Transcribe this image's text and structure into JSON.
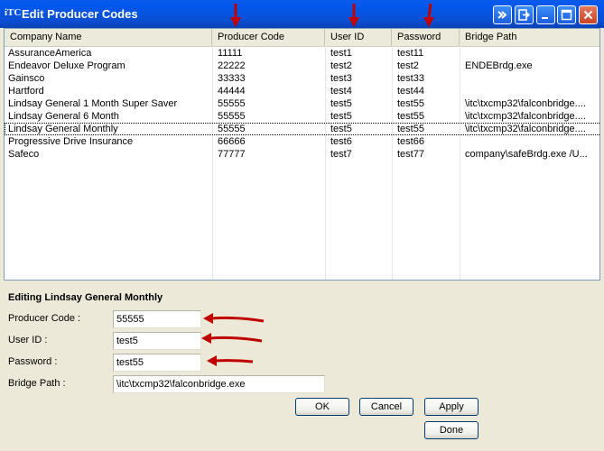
{
  "window": {
    "icon_text": "iTC",
    "title": "Edit Producer Codes"
  },
  "list": {
    "columns": [
      "Company Name",
      "Producer Code",
      "User ID",
      "Password",
      "Bridge Path"
    ],
    "rows": [
      [
        "AssuranceAmerica",
        "11111",
        "test1",
        "test11",
        ""
      ],
      [
        "Endeavor Deluxe Program",
        "22222",
        "test2",
        "test2",
        "ENDEBrdg.exe"
      ],
      [
        "Gainsco",
        "33333",
        "test3",
        "test33",
        ""
      ],
      [
        "Hartford",
        "44444",
        "test4",
        "test44",
        ""
      ],
      [
        "Lindsay General 1 Month Super Saver",
        "55555",
        "test5",
        "test55",
        "\\itc\\txcmp32\\falconbridge...."
      ],
      [
        "Lindsay General 6 Month",
        "55555",
        "test5",
        "test55",
        "\\itc\\txcmp32\\falconbridge...."
      ],
      [
        "Lindsay General Monthly",
        "55555",
        "test5",
        "test55",
        "\\itc\\txcmp32\\falconbridge...."
      ],
      [
        "Progressive Drive Insurance",
        "66666",
        "test6",
        "test66",
        ""
      ],
      [
        "Safeco",
        "77777",
        "test7",
        "test77",
        "company\\safeBrdg.exe /U..."
      ]
    ]
  },
  "editor": {
    "title": "Editing Lindsay General Monthly",
    "producer_code_label": "Producer Code :",
    "producer_code_value": "55555",
    "user_id_label": "User ID :",
    "user_id_value": "test5",
    "password_label": "Password :",
    "password_value": "test55",
    "bridge_path_label": "Bridge Path :",
    "bridge_path_value": "\\itc\\txcmp32\\falconbridge.exe"
  },
  "buttons": {
    "ok": "OK",
    "cancel": "Cancel",
    "apply": "Apply",
    "done": "Done"
  },
  "colors": {
    "annotation_arrow": "#c00000",
    "titlebar": "#0a4fd4"
  }
}
